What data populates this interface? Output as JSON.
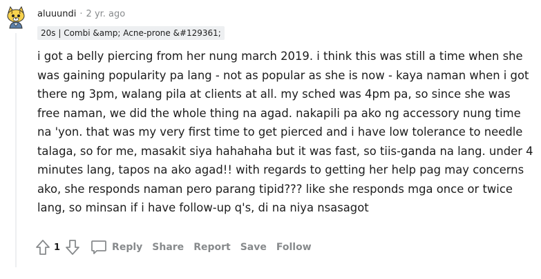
{
  "comment": {
    "author": "aluuundi",
    "separator": "·",
    "timestamp": "2 yr. ago",
    "flair": "20s | Combi &amp; Acne-prone &#129361;",
    "body": "i got a belly piercing from her nung march 2019. i think this was still a time when she was gaining popularity pa lang - not as popular as she is now - kaya naman when i got there ng 3pm, walang pila at clients at all. my sched was 4pm pa, so since she was free naman, we did the whole thing na agad. nakapili pa ako ng accessory nung time na 'yon. that was my very first time to get pierced and i have low tolerance to needle talaga, so for me, masakit siya hahahaha but it was fast, so tiis-ganda na lang. under 4 minutes lang, tapos na ako agad!! with regards to getting her help pag may concerns ako, she responds naman pero parang tipid??? like she responds mga once or twice lang, so minsan if i have follow-up q's, di na niya nsasagot",
    "score": "1"
  },
  "actions": {
    "reply": "Reply",
    "share": "Share",
    "report": "Report",
    "save": "Save",
    "follow": "Follow"
  },
  "icons": {
    "upvote": "upvote-arrow-icon",
    "downvote": "downvote-arrow-icon",
    "reply": "speech-bubble-icon",
    "avatar": "snoo-avatar-icon"
  },
  "colors": {
    "text": "#1c1c1c",
    "meta": "#878a8c",
    "flair_bg": "#edeff1",
    "thread_line": "#edeff1"
  }
}
